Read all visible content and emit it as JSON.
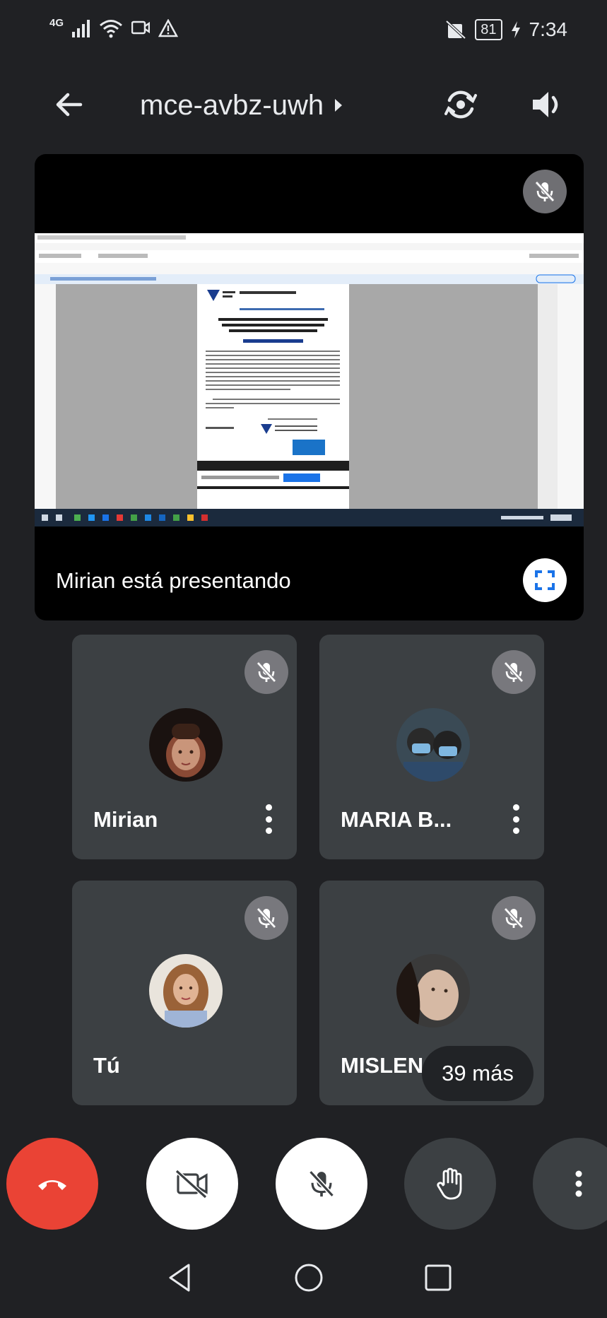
{
  "status_bar": {
    "network": "4G",
    "battery": "81",
    "time": "7:34",
    "icons": [
      "signal-icon",
      "wifi-icon",
      "cast-icon",
      "warning-icon",
      "silent-icon",
      "charging-icon"
    ]
  },
  "app_bar": {
    "meeting_code": "mce-avbz-uwh",
    "icons": [
      "back-arrow-icon",
      "caret-right-icon",
      "switch-camera-icon",
      "speaker-icon"
    ]
  },
  "presentation": {
    "presenter_label": "Mirian está presentando",
    "icons": [
      "mic-off-icon",
      "fullscreen-icon"
    ]
  },
  "participants": [
    {
      "name": "Mirian",
      "muted": true
    },
    {
      "name": "MARIA B...",
      "muted": true
    },
    {
      "name": "Tú",
      "muted": true
    },
    {
      "name": "MISLEN",
      "muted": true
    }
  ],
  "more_participants": "39 más",
  "controls": {
    "icons": [
      "end-call-icon",
      "camera-off-icon",
      "mic-off-icon",
      "raise-hand-icon",
      "more-vertical-icon"
    ]
  },
  "colors": {
    "background": "#202124",
    "tile": "#3c4043",
    "end_call": "#ea4335",
    "accent": "#1a73e8"
  },
  "nav_bar": {
    "icons": [
      "back-triangle-icon",
      "home-circle-icon",
      "recents-square-icon"
    ]
  }
}
